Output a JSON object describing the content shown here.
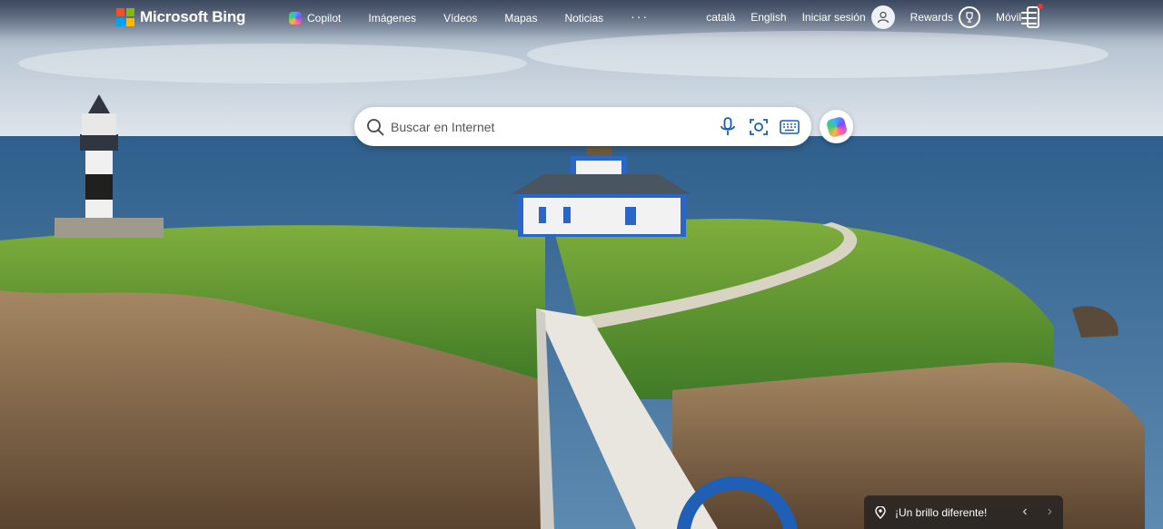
{
  "brand": {
    "name": "Microsoft Bing",
    "colors": [
      "#f25022",
      "#7fba00",
      "#00a4ef",
      "#ffb900"
    ]
  },
  "nav": {
    "items": [
      {
        "label": "Copilot",
        "icon": "copilot-icon"
      },
      {
        "label": "Imágenes"
      },
      {
        "label": "Vídeos"
      },
      {
        "label": "Mapas"
      },
      {
        "label": "Noticias"
      }
    ],
    "more": "···"
  },
  "header_right": {
    "lang1": "català",
    "lang2": "English",
    "signin": "Iniciar sesión",
    "rewards": "Rewards",
    "mobile": "Móvil"
  },
  "search": {
    "placeholder": "Buscar en Internet",
    "value": ""
  },
  "caption": {
    "text": "¡Un brillo diferente!",
    "prev": "‹",
    "next": "›"
  }
}
